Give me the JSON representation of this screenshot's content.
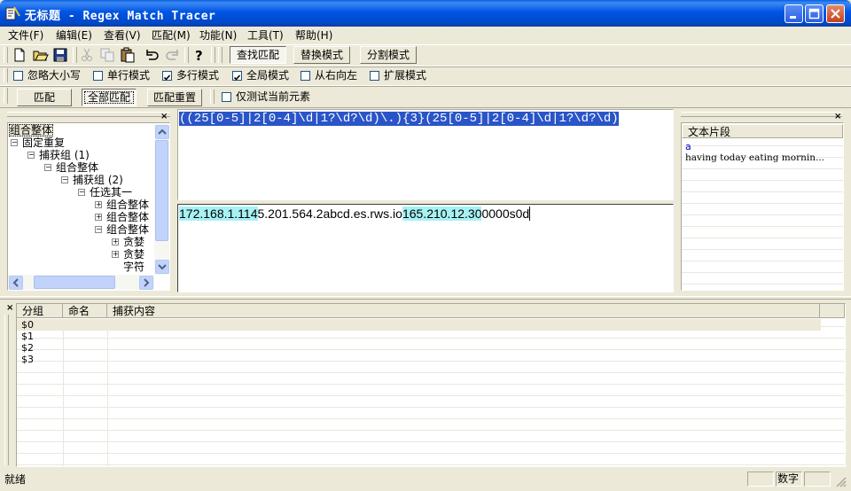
{
  "window": {
    "title": "无标题 - Regex Match Tracer"
  },
  "menu": [
    "文件(F)",
    "编辑(E)",
    "查看(V)",
    "匹配(M)",
    "功能(N)",
    "工具(T)",
    "帮助(H)"
  ],
  "modes": {
    "find": "查找匹配",
    "replace": "替换模式",
    "split": "分割模式"
  },
  "options": [
    {
      "label": "忽略大小写",
      "checked": false
    },
    {
      "label": "单行模式",
      "checked": false
    },
    {
      "label": "多行模式",
      "checked": true
    },
    {
      "label": "全局模式",
      "checked": true
    },
    {
      "label": "从右向左",
      "checked": false
    },
    {
      "label": "扩展模式",
      "checked": false
    }
  ],
  "actions": {
    "match": "匹配",
    "match_all": "全部匹配",
    "match_reset": "匹配重置",
    "test_current": "仅测试当前元素",
    "test_current_checked": false
  },
  "tree": {
    "selected": "组合整体",
    "nodes": [
      {
        "label": "组合整体",
        "toggle": ""
      },
      {
        "label": "固定重复",
        "toggle": "−"
      },
      {
        "label": "捕获组 (1)",
        "toggle": "−"
      },
      {
        "label": "组合整体",
        "toggle": "−"
      },
      {
        "label": "捕获组 (2)",
        "toggle": "−"
      },
      {
        "label": "任选其一",
        "toggle": "−"
      },
      {
        "label": "组合整体",
        "toggle": "+"
      },
      {
        "label": "组合整体",
        "toggle": "+"
      },
      {
        "label": "组合整体",
        "toggle": "−"
      },
      {
        "label": "贪婪",
        "toggle": "+"
      },
      {
        "label": "贪婪",
        "toggle": "+"
      },
      {
        "label": "字符",
        "toggle": ""
      }
    ]
  },
  "regex": {
    "pattern": "((25[0-5]|2[0-4]\\d|1?\\d?\\d)\\.){3}(25[0-5]|2[0-4]\\d|1?\\d?\\d)"
  },
  "text": {
    "segments": [
      {
        "t": "172.168.1.114",
        "m": true
      },
      {
        "t": "5.201.564.2abcd.es.rws.io",
        "m": false
      },
      {
        "t": "165.210.12.30",
        "m": true
      },
      {
        "t": "0000s0d",
        "m": false
      }
    ]
  },
  "snippets": {
    "header": "文本片段",
    "items": [
      "a",
      "having today eating mornin..."
    ]
  },
  "results": {
    "columns": [
      "分组",
      "命名",
      "捕获内容"
    ],
    "rows": [
      {
        "group": "$0",
        "name": "",
        "content": ""
      },
      {
        "group": "$1",
        "name": "",
        "content": ""
      },
      {
        "group": "$2",
        "name": "",
        "content": ""
      },
      {
        "group": "$3",
        "name": "",
        "content": ""
      }
    ]
  },
  "status": {
    "left": "就绪",
    "mode": "数字"
  }
}
